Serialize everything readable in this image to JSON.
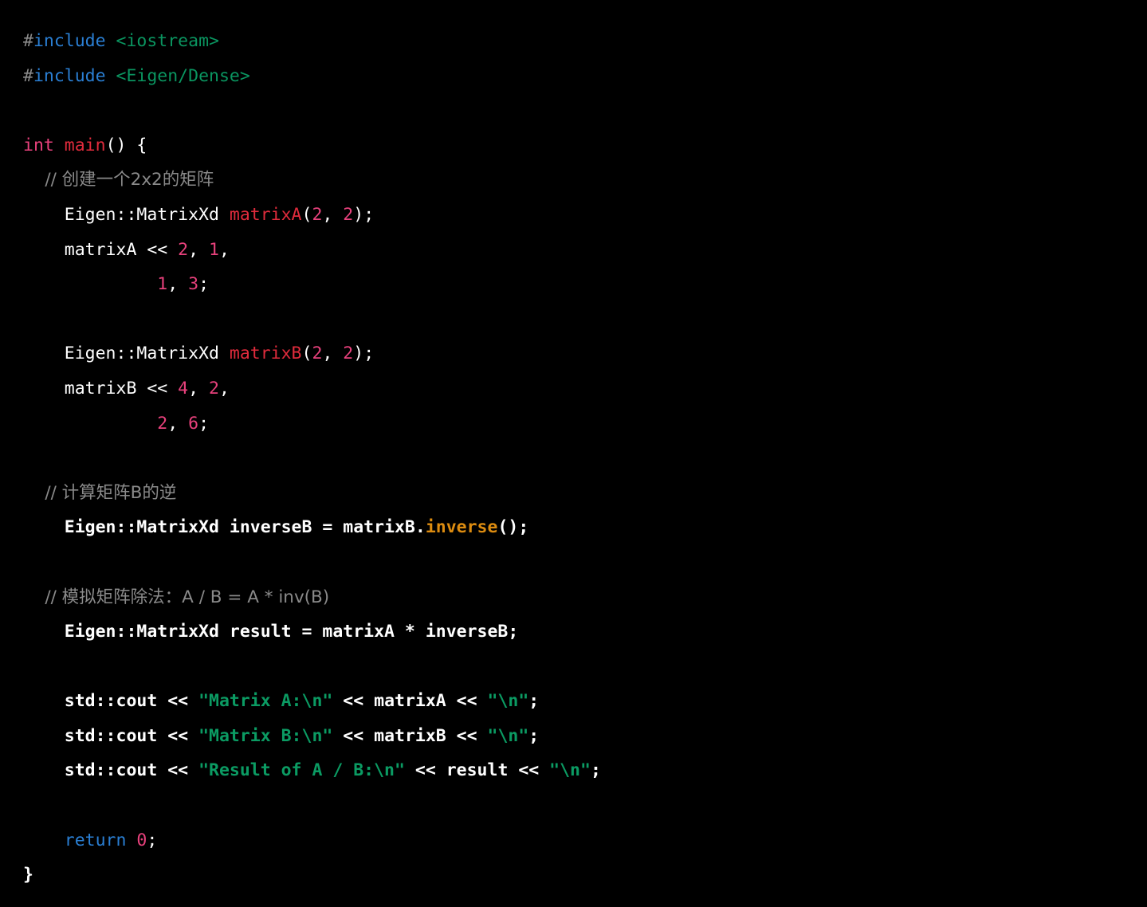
{
  "editor": {
    "background_color": "#000000",
    "language": "cpp",
    "font_size_px": 21.5,
    "line_height_px": 43.6
  },
  "theme": {
    "plain": "#ffffff",
    "hash": "#8a8a8a",
    "keyword": "#2a7fd4",
    "type": "#e8417c",
    "function": "#e02b3c",
    "number": "#e8417c",
    "string": "#0b9b63",
    "header": "#0a9560",
    "comment": "#8a8a8a",
    "method": "#dd8c10"
  },
  "code": {
    "line_1": {
      "hash": "#",
      "keyword": "include",
      "space": " ",
      "header": "<iostream>"
    },
    "line_2": {
      "hash": "#",
      "keyword": "include",
      "space": " ",
      "header": "<Eigen/Dense>"
    },
    "line_4": {
      "type": "int",
      "space": " ",
      "func": "main",
      "tail": "() {"
    },
    "line_5": {
      "comment": "    // 创建一个2x2的矩阵"
    },
    "line_6": {
      "head": "    Eigen::MatrixXd ",
      "func": "matrixA",
      "open": "(",
      "num1": "2",
      "sep": ", ",
      "num2": "2",
      "close": ");"
    },
    "line_7": {
      "head": "    matrixA << ",
      "num1": "2",
      "sep": ", ",
      "num2": "1",
      "tail": ","
    },
    "line_8": {
      "indent": "             ",
      "num1": "1",
      "sep": ", ",
      "num2": "3",
      "tail": ";"
    },
    "line_10": {
      "head": "    Eigen::MatrixXd ",
      "func": "matrixB",
      "open": "(",
      "num1": "2",
      "sep": ", ",
      "num2": "2",
      "close": ");"
    },
    "line_11": {
      "head": "    matrixB << ",
      "num1": "4",
      "sep": ", ",
      "num2": "2",
      "tail": ","
    },
    "line_12": {
      "indent": "             ",
      "num1": "2",
      "sep": ", ",
      "num2": "6",
      "tail": ";"
    },
    "line_14": {
      "comment": "    // 计算矩阵B的逆"
    },
    "line_15": {
      "head": "    Eigen::MatrixXd inverseB = matrixB.",
      "method": "inverse",
      "tail": "();"
    },
    "line_17": {
      "comment": "    // 模拟矩阵除法：A / B = A * inv(B)"
    },
    "line_18": {
      "text": "    Eigen::MatrixXd result = matrixA * inverseB;"
    },
    "line_20": {
      "head": "    std::cout << ",
      "string": "\"Matrix A:\\n\"",
      "mid": " << matrixA << ",
      "string2": "\"\\n\"",
      "tail": ";"
    },
    "line_21": {
      "head": "    std::cout << ",
      "string": "\"Matrix B:\\n\"",
      "mid": " << matrixB << ",
      "string2": "\"\\n\"",
      "tail": ";"
    },
    "line_22": {
      "head": "    std::cout << ",
      "string": "\"Result of A / B:\\n\"",
      "mid": " << result << ",
      "string2": "\"\\n\"",
      "tail": ";"
    },
    "line_24": {
      "indent": "    ",
      "keyword": "return",
      "space": " ",
      "number": "0",
      "tail": ";"
    },
    "line_25": {
      "text": "}"
    }
  }
}
